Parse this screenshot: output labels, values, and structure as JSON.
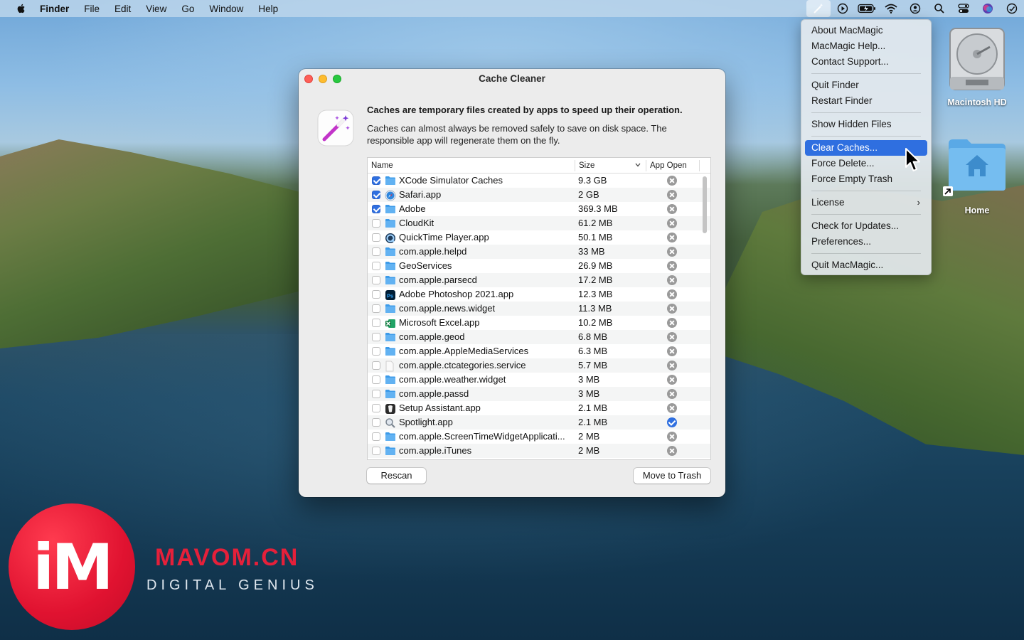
{
  "menubar": {
    "items": [
      "Finder",
      "File",
      "Edit",
      "View",
      "Go",
      "Window",
      "Help"
    ]
  },
  "status_icons": [
    "magic-wand-icon",
    "play-icon",
    "battery-icon",
    "wifi-icon",
    "user-icon",
    "search-icon",
    "control-center-icon",
    "siri-icon",
    "clock-icon"
  ],
  "dropdown": {
    "groups": [
      [
        "About MacMagic",
        "MacMagic Help...",
        "Contact Support..."
      ],
      [
        "Quit Finder",
        "Restart Finder"
      ],
      [
        "Show Hidden Files"
      ],
      [
        "Clear Caches...",
        "Force Delete...",
        "Force Empty Trash"
      ],
      [
        "License"
      ],
      [
        "Check for Updates...",
        "Preferences..."
      ],
      [
        "Quit MacMagic..."
      ]
    ],
    "highlighted": "Clear Caches..."
  },
  "desktop": {
    "drive_label": "Macintosh HD",
    "home_label": "Home"
  },
  "window": {
    "title": "Cache Cleaner",
    "headline": "Caches are temporary files created by apps to speed up their operation.",
    "description": "Caches can almost always be removed safely to save on disk space. The responsible app will regenerate them on the fly.",
    "columns": {
      "name": "Name",
      "size": "Size",
      "open": "App Open"
    },
    "rows": [
      {
        "checked": true,
        "icon": "folder-icon",
        "name": "XCode Simulator Caches",
        "size": "9.3 GB",
        "open": false
      },
      {
        "checked": true,
        "icon": "safari-icon",
        "name": "Safari.app",
        "size": "2 GB",
        "open": false
      },
      {
        "checked": true,
        "icon": "folder-icon",
        "name": "Adobe",
        "size": "369.3 MB",
        "open": false
      },
      {
        "checked": false,
        "icon": "folder-icon",
        "name": "CloudKit",
        "size": "61.2 MB",
        "open": false
      },
      {
        "checked": false,
        "icon": "quicktime-icon",
        "name": "QuickTime Player.app",
        "size": "50.1 MB",
        "open": false
      },
      {
        "checked": false,
        "icon": "folder-icon",
        "name": "com.apple.helpd",
        "size": "33 MB",
        "open": false
      },
      {
        "checked": false,
        "icon": "folder-icon",
        "name": "GeoServices",
        "size": "26.9 MB",
        "open": false
      },
      {
        "checked": false,
        "icon": "folder-icon",
        "name": "com.apple.parsecd",
        "size": "17.2 MB",
        "open": false
      },
      {
        "checked": false,
        "icon": "photoshop-icon",
        "name": "Adobe Photoshop 2021.app",
        "size": "12.3 MB",
        "open": false
      },
      {
        "checked": false,
        "icon": "folder-icon",
        "name": "com.apple.news.widget",
        "size": "11.3 MB",
        "open": false
      },
      {
        "checked": false,
        "icon": "excel-icon",
        "name": "Microsoft Excel.app",
        "size": "10.2 MB",
        "open": false
      },
      {
        "checked": false,
        "icon": "folder-icon",
        "name": "com.apple.geod",
        "size": "6.8 MB",
        "open": false
      },
      {
        "checked": false,
        "icon": "folder-icon",
        "name": "com.apple.AppleMediaServices",
        "size": "6.3 MB",
        "open": false
      },
      {
        "checked": false,
        "icon": "document-icon",
        "name": "com.apple.ctcategories.service",
        "size": "5.7 MB",
        "open": false
      },
      {
        "checked": false,
        "icon": "folder-icon",
        "name": "com.apple.weather.widget",
        "size": "3 MB",
        "open": false
      },
      {
        "checked": false,
        "icon": "folder-icon",
        "name": "com.apple.passd",
        "size": "3 MB",
        "open": false
      },
      {
        "checked": false,
        "icon": "setup-assistant-icon",
        "name": "Setup Assistant.app",
        "size": "2.1 MB",
        "open": false
      },
      {
        "checked": false,
        "icon": "spotlight-icon",
        "name": "Spotlight.app",
        "size": "2.1 MB",
        "open": true
      },
      {
        "checked": false,
        "icon": "folder-icon",
        "name": "com.apple.ScreenTimeWidgetApplicati...",
        "size": "2 MB",
        "open": false
      },
      {
        "checked": false,
        "icon": "folder-icon",
        "name": "com.apple.iTunes",
        "size": "2 MB",
        "open": false
      }
    ],
    "buttons": {
      "rescan": "Rescan",
      "trash": "Move to Trash"
    }
  },
  "watermark": {
    "logo": "iM",
    "site": "MAVOM.CN",
    "tagline": "DIGITAL GENIUS"
  }
}
